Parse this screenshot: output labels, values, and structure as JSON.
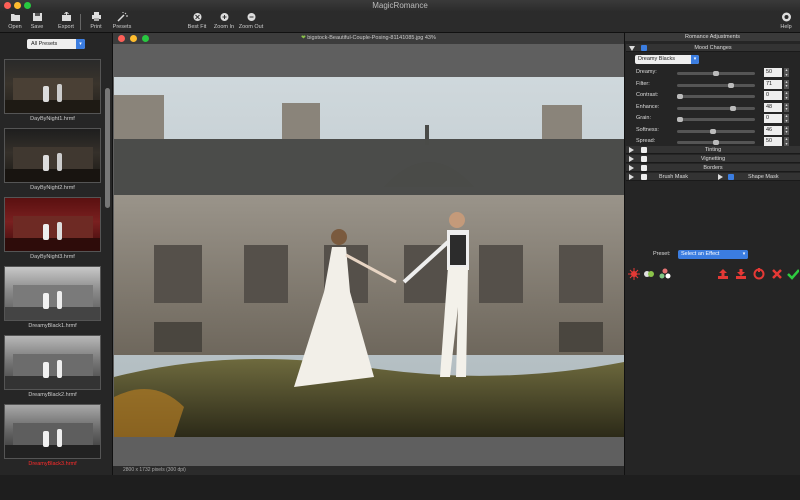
{
  "app": {
    "title": "MagicRomance"
  },
  "toolbar": {
    "open": "Open",
    "save": "Save",
    "export": "Export",
    "print": "Print",
    "presets": "Presets",
    "best_fit": "Best Fit",
    "zoom_in": "Zoom In",
    "zoom_out": "Zoom Out",
    "help": "Help"
  },
  "presets_panel": {
    "selector": "All Presets",
    "items": [
      {
        "label": "DayByNight1.hrmf"
      },
      {
        "label": "DayByNight2.hrmf"
      },
      {
        "label": "DayByNight3.hrmf"
      },
      {
        "label": "DreamyBlack1.hrmf"
      },
      {
        "label": "DreamyBlack2.hrmf"
      },
      {
        "label": "DreamyBlack3.hrmf"
      }
    ]
  },
  "document": {
    "title": "bigstock-Beautiful-Couple-Posing-81141085.jpg 43%",
    "status": "2800 x 1732 pixels (300 dpi)"
  },
  "adjustments": {
    "panel_title": "Romance Adjustments",
    "mood_section": "Mood Changes",
    "mood_preset": "Dreamy Blacks",
    "params": [
      {
        "label": "Dreamy:",
        "value": "50",
        "level": 0.5
      },
      {
        "label": "Filter:",
        "value": "71",
        "level": 0.71
      },
      {
        "label": "Contrast:",
        "value": "0",
        "level": 0.0
      },
      {
        "label": "Enhance:",
        "value": "48",
        "level": 0.74
      },
      {
        "label": "Grain:",
        "value": "0",
        "level": 0.0
      },
      {
        "label": "Softness:",
        "value": "46",
        "level": 0.46
      },
      {
        "label": "Spread:",
        "value": "50",
        "level": 0.5
      }
    ],
    "tinting": "Tinting",
    "vignetting": "Vignetting",
    "borders": "Borders",
    "brush_mask": "Brush Mask",
    "shape_mask": "Shape Mask",
    "preset_label": "Preset:",
    "effect_select": "Select an Effect"
  },
  "colors": {
    "accent": "#3b7de0",
    "selected_text": "#ff2b2b",
    "apply": "#2ecc40",
    "cancel": "#e53935"
  }
}
